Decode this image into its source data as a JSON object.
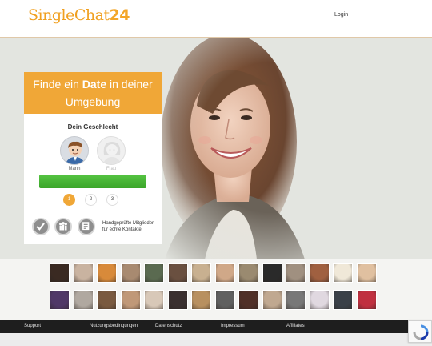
{
  "header": {
    "logo_text": "SingleChat",
    "logo_number": "24",
    "login_label": "Login"
  },
  "hero": {
    "headline_pre": "Finde ein ",
    "headline_bold": "Date",
    "headline_mid": " in deiner",
    "headline_post": "Umgebung"
  },
  "form": {
    "gender_title": "Dein Geschlecht",
    "male_label": "Mann",
    "female_label": "Frau",
    "steps": [
      "1",
      "2",
      "3"
    ],
    "trust_text": "Handgeprüfte Mitglieder für echte Kontakte"
  },
  "gallery": {
    "row1_colors": [
      "#3a2a22",
      "#c9b3a0",
      "#d88a3a",
      "#a88a70",
      "#5a6a50",
      "#6a5040",
      "#c8b090",
      "#d0a888",
      "#9a8a70",
      "#2a2a2a",
      "#a09080",
      "#a06040",
      "#f0e8d8",
      "#e0c0a0"
    ],
    "row2_colors": [
      "#503868",
      "#b0a8a0",
      "#7a5a40",
      "#c09878",
      "#d8c8b8",
      "#3a3030",
      "#b89060",
      "#606060",
      "#503028",
      "#c0a890",
      "#787878",
      "#e0d8e0",
      "#3a4048",
      "#c03040"
    ]
  },
  "footer": {
    "links": [
      "Support",
      "Nutzungsbedingungen",
      "Datenschutz",
      "Impressum",
      "Affiliates"
    ]
  },
  "colors": {
    "brand": "#f0a020",
    "cta_green": "#45b334",
    "card_header": "#f0a737"
  },
  "icons": {
    "recaptcha": "recaptcha-icon"
  }
}
